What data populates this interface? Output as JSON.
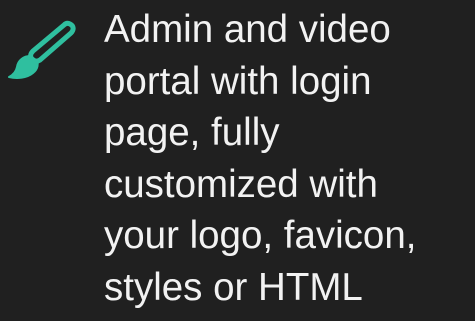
{
  "icon": {
    "name": "paintbrush-icon",
    "color": "#2fbf9f"
  },
  "feature": {
    "lines": [
      "Admin and video",
      "portal with login",
      "page, fully",
      "customized with",
      "your logo, favicon,",
      "styles or HTML"
    ]
  },
  "colors": {
    "background": "#202020",
    "text": "#f2f2f2",
    "accent": "#2fbf9f"
  }
}
